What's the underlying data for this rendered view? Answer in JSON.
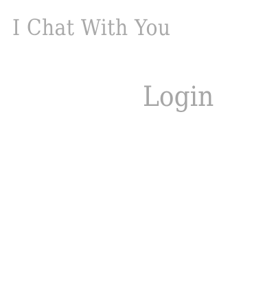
{
  "app": {
    "title": "I Chat With You"
  },
  "login": {
    "heading": "Login"
  },
  "colors": {
    "background": "#ffffff",
    "text": "#a9a9a9"
  }
}
